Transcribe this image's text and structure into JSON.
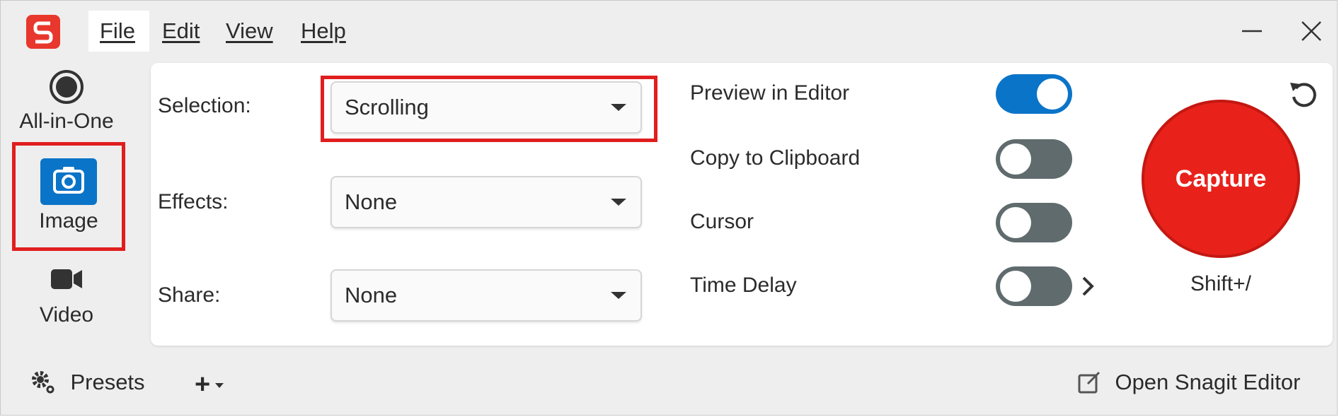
{
  "app": {
    "logo_icon": "snagit-logo-icon",
    "accent_color": "#e8372c"
  },
  "menu": {
    "file": "File",
    "edit": "Edit",
    "view": "View",
    "help": "Help"
  },
  "window_controls": {
    "minimize_icon": "minimize-icon",
    "close_icon": "close-icon"
  },
  "modes": {
    "all_in_one": {
      "label": "All-in-One",
      "icon": "record-dot-icon"
    },
    "image": {
      "label": "Image",
      "icon": "camera-icon",
      "selected": true
    },
    "video": {
      "label": "Video",
      "icon": "video-camera-icon"
    }
  },
  "settings": {
    "selection": {
      "label": "Selection:",
      "value": "Scrolling"
    },
    "effects": {
      "label": "Effects:",
      "value": "None"
    },
    "share": {
      "label": "Share:",
      "value": "None"
    }
  },
  "options": {
    "preview_in_editor": {
      "label": "Preview in Editor",
      "on": true
    },
    "copy_to_clipboard": {
      "label": "Copy to Clipboard",
      "on": false
    },
    "cursor": {
      "label": "Cursor",
      "on": false
    },
    "time_delay": {
      "label": "Time Delay",
      "on": false
    }
  },
  "capture": {
    "label": "Capture",
    "shortcut": "Shift+/",
    "color": "#e8221b"
  },
  "bottom": {
    "presets_label": "Presets",
    "add_label": "+",
    "open_editor_label": "Open Snagit Editor"
  },
  "colors": {
    "toggle_on": "#0a74c8",
    "toggle_off": "#5f6b6d",
    "highlight": "#e01e1e"
  }
}
